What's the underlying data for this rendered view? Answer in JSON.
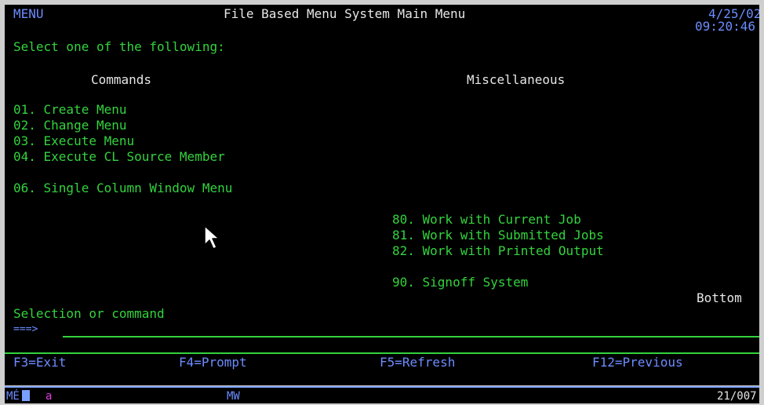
{
  "header": {
    "menu_id": "MENU",
    "title": "File Based Menu System Main Menu",
    "date": "4/25/02",
    "time": "09:20:46"
  },
  "instruction": "Select one of the following:",
  "commands": {
    "heading": "Commands",
    "items": [
      "01. Create Menu",
      "02. Change Menu",
      "03. Execute Menu",
      "04. Execute CL Source Member",
      "06. Single Column Window Menu"
    ]
  },
  "misc": {
    "heading": "Miscellaneous",
    "items": [
      "80. Work with Current Job",
      "81. Work with Submitted Jobs",
      "82. Work with Printed Output",
      "90. Signoff System"
    ]
  },
  "bottom_label": "Bottom",
  "selection_prompt": "Selection or command",
  "command_arrow": "===>",
  "command_value": "",
  "function_keys": [
    "F3=Exit",
    "F4=Prompt",
    "F5=Refresh",
    "F12=Previous"
  ],
  "status_bar": {
    "indicator": "MÉ",
    "input_char": "a",
    "mode": "MW",
    "cursor_pos": "21/007"
  },
  "colors": {
    "screen_bg": "#000000",
    "text_green": "#33d33d",
    "text_white": "#e6e6e6",
    "text_blue": "#6c8cff"
  }
}
